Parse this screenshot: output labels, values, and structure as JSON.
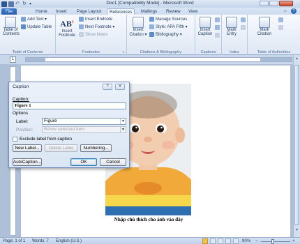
{
  "window": {
    "title": "Doc1 [Compatibility Mode] - Microsoft Word"
  },
  "tabs": [
    "File",
    "Home",
    "Insert",
    "Page Layout",
    "References",
    "Mailings",
    "Review",
    "View"
  ],
  "ribbon": {
    "toc": {
      "button_line1": "Table of",
      "button_line2": "Contents",
      "add_text": "Add Text",
      "update_table": "Update Table",
      "group_label": "Table of Contents"
    },
    "footnotes": {
      "insert_footnote_line1": "Insert",
      "insert_footnote_line2": "Footnote",
      "insert_endnote": "Insert Endnote",
      "next_footnote": "Next Footnote",
      "show_notes": "Show Notes",
      "group_label": "Footnotes"
    },
    "citations": {
      "insert_citation_line1": "Insert",
      "insert_citation_line2": "Citation",
      "manage_sources": "Manage Sources",
      "style_label": "Style:",
      "style_value": "APA Fifth",
      "bibliography": "Bibliography",
      "group_label": "Citations & Bibliography"
    },
    "captions": {
      "insert_caption_line1": "Insert",
      "insert_caption_line2": "Caption",
      "group_label": "Captions"
    },
    "index": {
      "mark_entry_line1": "Mark",
      "mark_entry_line2": "Entry",
      "group_label": "Index"
    },
    "toa": {
      "mark_citation_line1": "Mark",
      "mark_citation_line2": "Citation",
      "group_label": "Table of Authorities"
    }
  },
  "dialog": {
    "title": "Caption",
    "help_glyph": "?",
    "close_glyph": "✕",
    "caption_label": "Caption:",
    "caption_value": "Figure 1",
    "options_label": "Options",
    "label_label": "Label:",
    "label_value": "Figure",
    "position_label": "Position:",
    "position_value": "Below selected item",
    "exclude_label": "Exclude label from caption",
    "new_label_button": "New Label...",
    "delete_label_button": "Delete Label",
    "numbering_button": "Numbering...",
    "autocaption_button": "AutoCaption...",
    "ok_button": "OK",
    "cancel_button": "Cancel"
  },
  "document": {
    "caption_text": "Nhập chú thích cho ảnh vào đây"
  },
  "status": {
    "page": "Page: 1 of 1",
    "words": "Words: 7",
    "language": "English (U.S.)",
    "zoom": "90%",
    "zoom_out": "−",
    "zoom_in": "+"
  },
  "colors": {
    "file_tab": "#2a5da9",
    "ribbon_bg": "#dfe8f5",
    "dialog_bg": "#dbe6f4",
    "shirt_orange": "#f1a93a",
    "shirt_yellow": "#f6d64a",
    "shirt_blue": "#2d6fb0"
  }
}
